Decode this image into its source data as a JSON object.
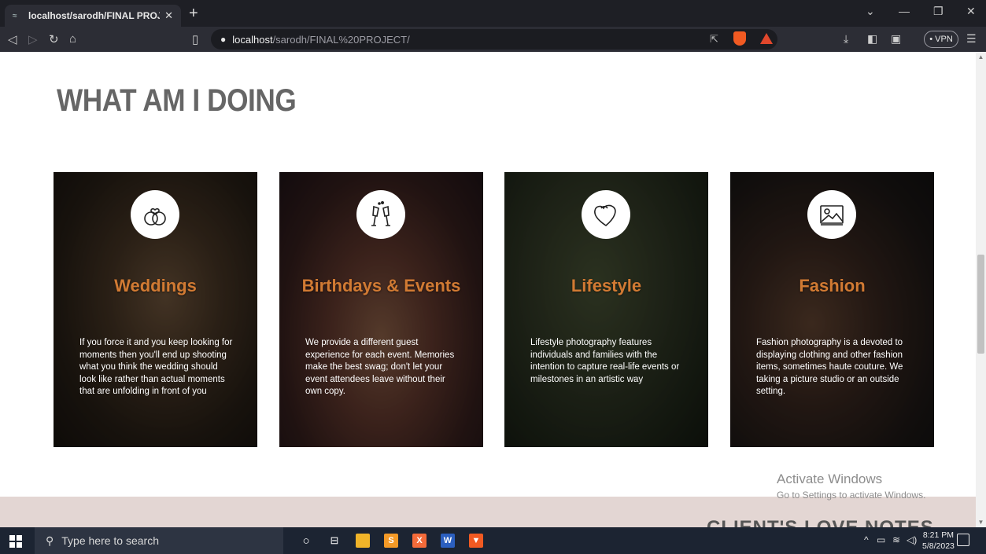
{
  "browser": {
    "tab_title": "localhost/sarodh/FINAL PROJECT",
    "url_host": "localhost",
    "url_path": "/sarodh/FINAL%20PROJECT/",
    "vpn_label": "• VPN"
  },
  "page": {
    "section_title": "WHAT AM I DOING",
    "next_section_title": "CLIENT'S LOVE NOTES",
    "cards": [
      {
        "title": "Weddings",
        "icon": "rings-icon",
        "text": "If you force it and you keep looking for moments then you'll end up shooting what you think the wedding should look like rather than actual moments that are unfolding in front of you"
      },
      {
        "title": "Birthdays & Events",
        "icon": "champagne-glasses-icon",
        "text": "We provide a different guest experience for each event. Memories make the best swag; don't let your event attendees leave without their own copy."
      },
      {
        "title": "Lifestyle",
        "icon": "heart-icon",
        "text": "Lifestyle photography features individuals and families with the intention to capture real-life events or milestones in an artistic way"
      },
      {
        "title": "Fashion",
        "icon": "picture-icon",
        "text": "Fashion photography is a devoted to displaying clothing and other fashion items, sometimes haute couture. We taking a picture studio or an outside setting."
      }
    ],
    "colors": {
      "card_title": "#d17a33",
      "heading": "#666666",
      "band": "#e3d6d3"
    }
  },
  "watermark": {
    "title": "Activate Windows",
    "subtitle": "Go to Settings to activate Windows."
  },
  "taskbar": {
    "search_placeholder": "Type here to search",
    "time": "8:21 PM",
    "date": "5/8/2023"
  }
}
